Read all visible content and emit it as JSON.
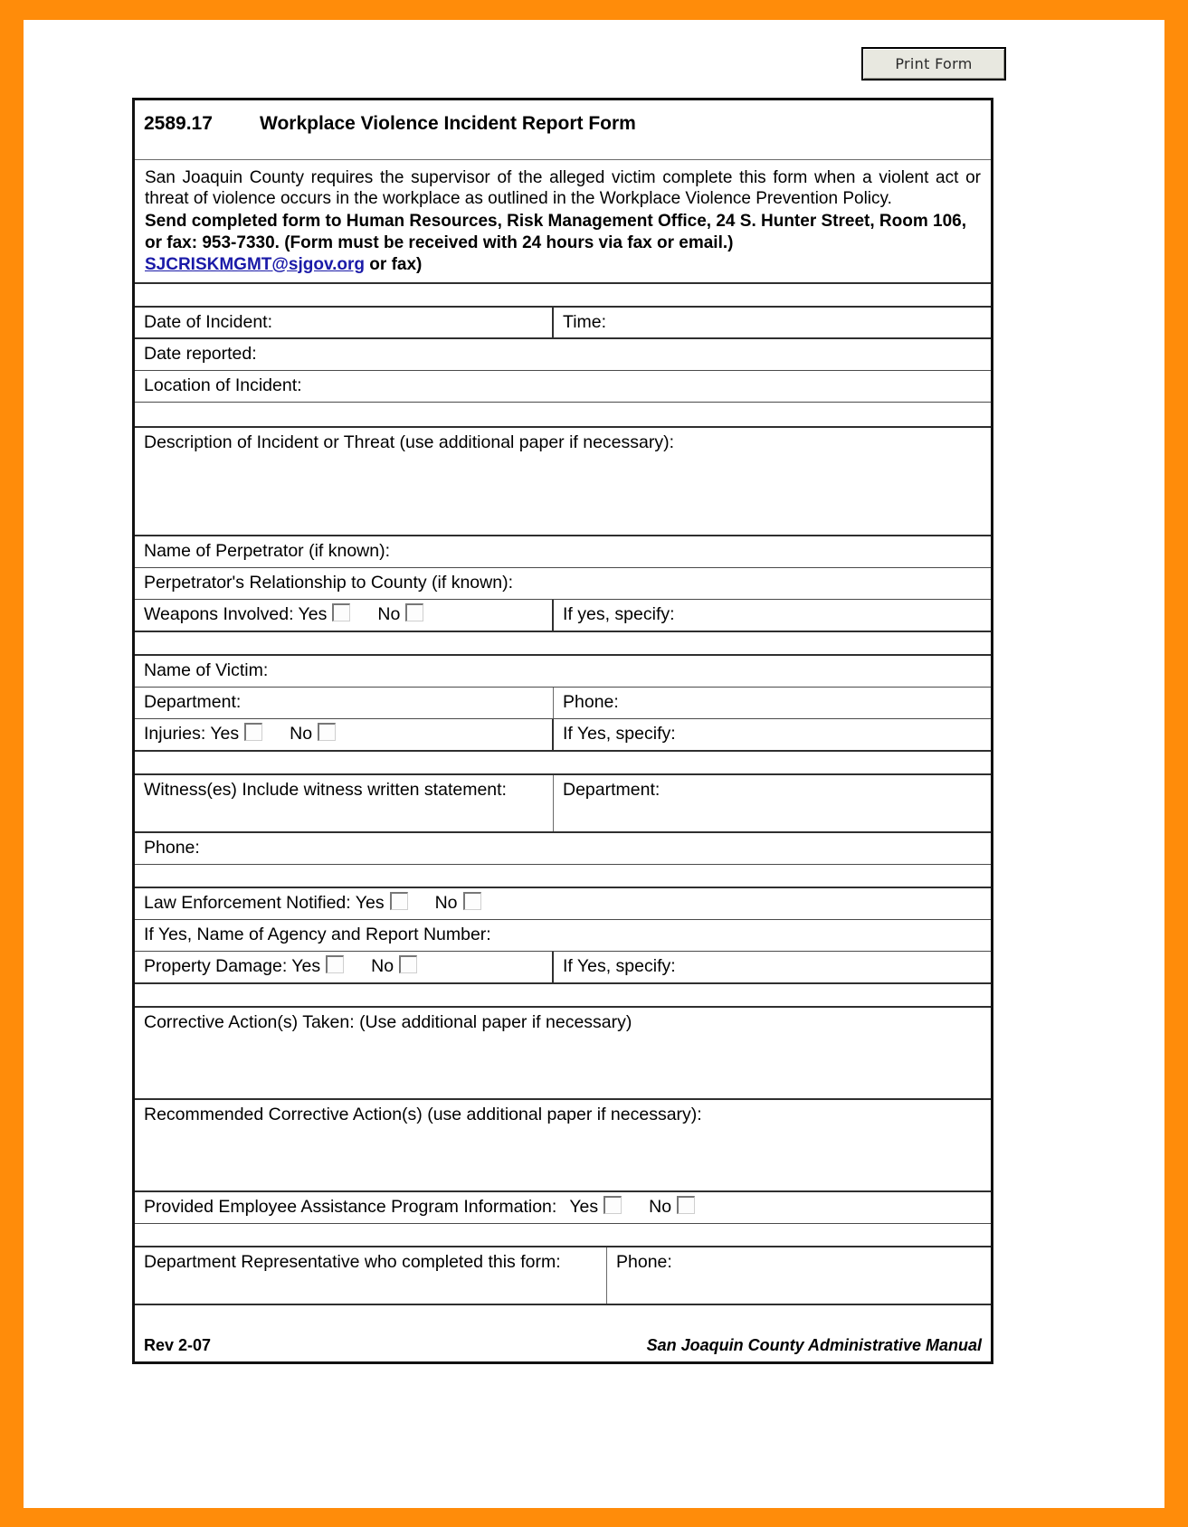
{
  "toolbar": {
    "print_label": "Print Form"
  },
  "form": {
    "number": "2589.17",
    "title": "Workplace Violence Incident Report Form",
    "intro": {
      "paragraph": "San Joaquin County requires the supervisor of the alleged victim complete this form when a violent act or threat of violence occurs in the workplace as outlined in the Workplace Violence Prevention Policy.",
      "bold_line1": "Send completed form to Human Resources, Risk Management Office, 24 S. Hunter Street, Room 106, or fax:  953-7330.  (Form must be received with 24 hours via fax or email.)",
      "email": "SJCRISKMGMT@sjgov.org",
      "email_suffix": " or fax)"
    },
    "fields": {
      "date_of_incident": "Date of Incident:",
      "time": "Time:",
      "date_reported": "Date reported:",
      "location_of_incident": "Location of Incident:",
      "description": "Description of Incident or Threat (use additional paper if necessary):",
      "name_of_perpetrator": "Name of Perpetrator (if known):",
      "perpetrator_relationship": "Perpetrator's Relationship to County (if known):",
      "weapons_involved": "Weapons Involved: Yes",
      "weapons_no": "No",
      "if_yes_specify_lower": "If yes, specify:",
      "name_of_victim": "Name of Victim:",
      "department": "Department:",
      "phone": "Phone:",
      "injuries": "Injuries: Yes",
      "injuries_no": "No",
      "if_yes_specify": "If Yes, specify:",
      "witness": "Witness(es) Include witness written statement:",
      "witness_department": "Department:",
      "witness_phone": "Phone:",
      "law_enforcement": "Law Enforcement Notified: Yes",
      "law_enforcement_no": "No",
      "agency_report_number": "If Yes, Name of Agency and Report Number:",
      "property_damage": "Property Damage: Yes",
      "property_damage_no": "No",
      "property_if_yes_specify": "If Yes, specify:",
      "corrective_actions_taken": "Corrective Action(s) Taken: (Use additional paper if necessary)",
      "recommended_corrective_actions": "Recommended Corrective Action(s) (use additional paper if necessary):",
      "eap_info": "Provided Employee Assistance Program Information:",
      "eap_yes": "Yes",
      "eap_no": "No",
      "dept_representative": "Department Representative who completed this form:",
      "dept_representative_phone": "Phone:"
    },
    "footer": {
      "revision": "Rev 2-07",
      "manual": "San Joaquin County Administrative Manual"
    }
  },
  "colors": {
    "scan_border": "#ff8c0a",
    "link": "#1a1aa8",
    "rule": "#2f2f2f"
  }
}
